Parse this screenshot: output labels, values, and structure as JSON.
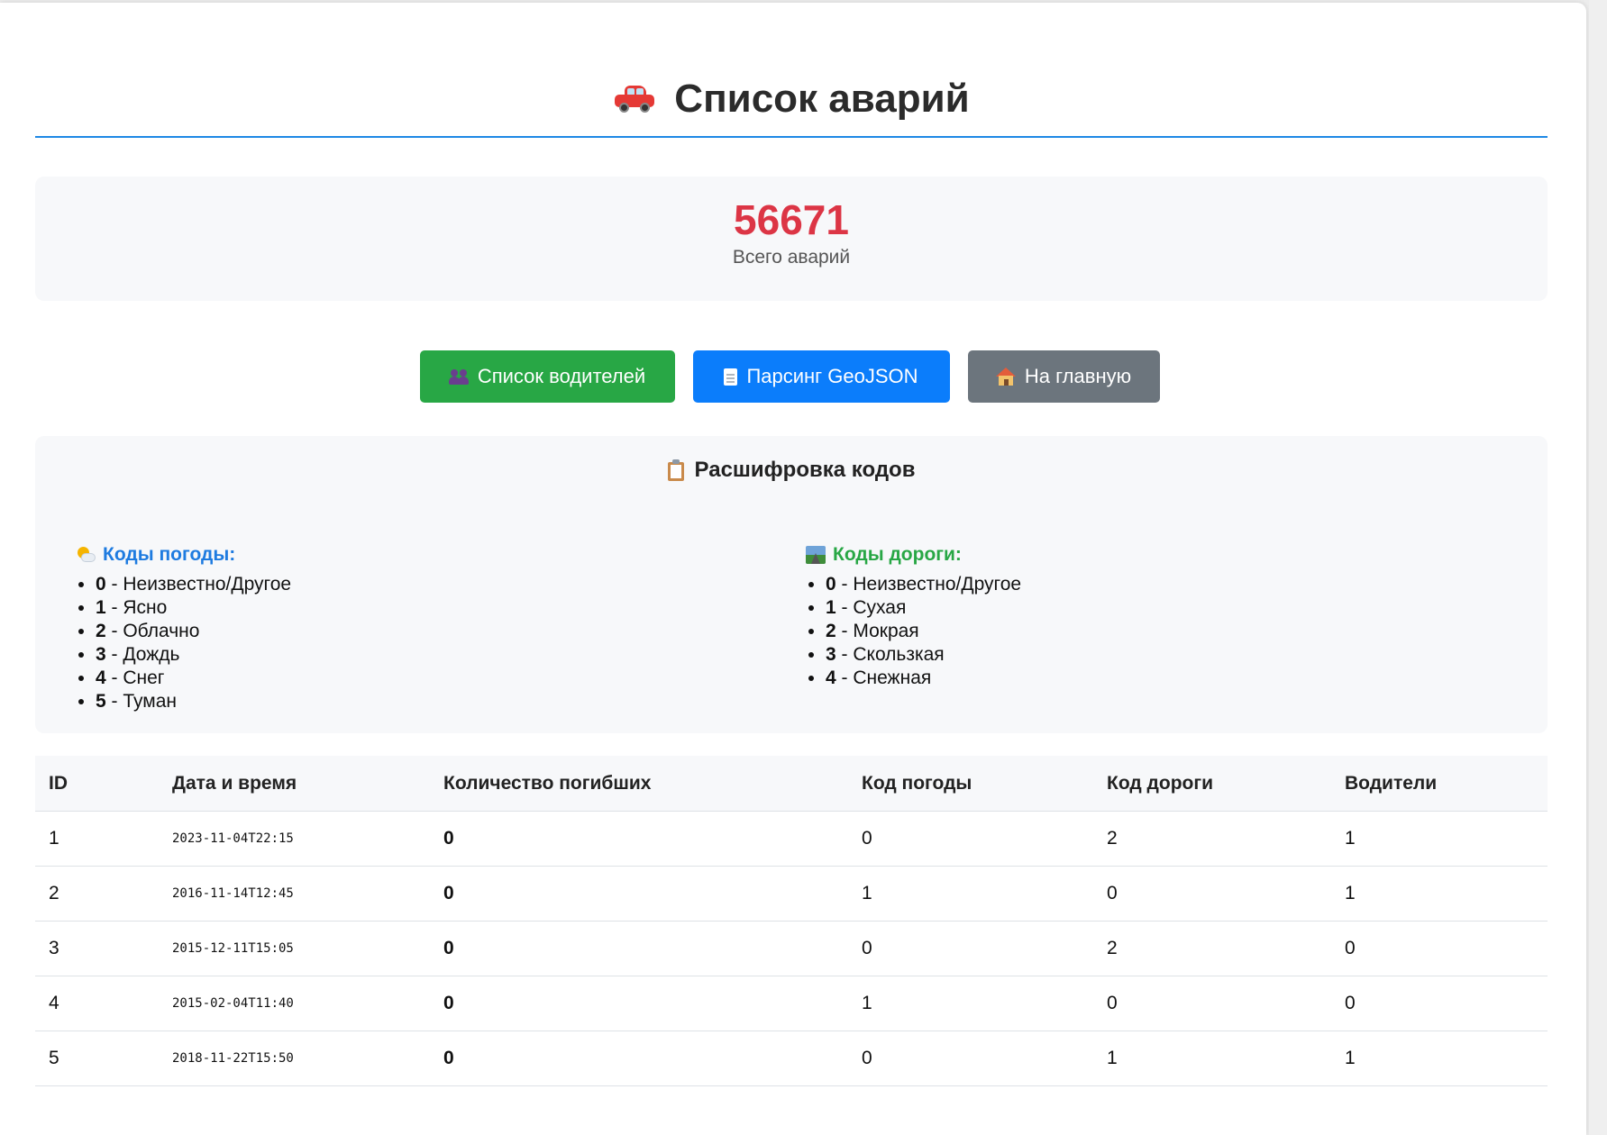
{
  "page": {
    "title": "Список аварий"
  },
  "stats": {
    "total_value": "56671",
    "total_label": "Всего аварий"
  },
  "buttons": {
    "drivers": "Список водителей",
    "geojson": "Парсинг GeoJSON",
    "home": "На главную"
  },
  "codes": {
    "title": "Расшифровка кодов",
    "weather_title": "Коды погоды:",
    "weather": [
      {
        "code": "0",
        "text": " - Неизвестно/Другое"
      },
      {
        "code": "1",
        "text": " - Ясно"
      },
      {
        "code": "2",
        "text": " - Облачно"
      },
      {
        "code": "3",
        "text": " - Дождь"
      },
      {
        "code": "4",
        "text": " - Снег"
      },
      {
        "code": "5",
        "text": " - Туман"
      }
    ],
    "road_title": "Коды дороги:",
    "road": [
      {
        "code": "0",
        "text": " - Неизвестно/Другое"
      },
      {
        "code": "1",
        "text": " - Сухая"
      },
      {
        "code": "2",
        "text": " - Мокрая"
      },
      {
        "code": "3",
        "text": " - Скользкая"
      },
      {
        "code": "4",
        "text": " - Снежная"
      }
    ]
  },
  "table": {
    "headers": [
      "ID",
      "Дата и время",
      "Количество погибших",
      "Код погоды",
      "Код дороги",
      "Водители"
    ],
    "rows": [
      [
        "1",
        "2023-11-04T22:15",
        "0",
        "0",
        "2",
        "1"
      ],
      [
        "2",
        "2016-11-14T12:45",
        "0",
        "1",
        "0",
        "1"
      ],
      [
        "3",
        "2015-12-11T15:05",
        "0",
        "0",
        "2",
        "0"
      ],
      [
        "4",
        "2015-02-04T11:40",
        "0",
        "1",
        "0",
        "0"
      ],
      [
        "5",
        "2018-11-22T15:50",
        "0",
        "0",
        "1",
        "1"
      ]
    ]
  },
  "colors": {
    "accent": "#1e88e5",
    "danger": "#dc3545",
    "success": "#28a745",
    "primary": "#0b7dfb",
    "secondary": "#6c757d"
  },
  "icons": {
    "title": "car-icon",
    "drivers": "people-icon",
    "geojson": "document-icon",
    "home": "house-icon",
    "codes": "clipboard-icon",
    "weather": "sun-cloud-icon",
    "road": "road-icon"
  }
}
